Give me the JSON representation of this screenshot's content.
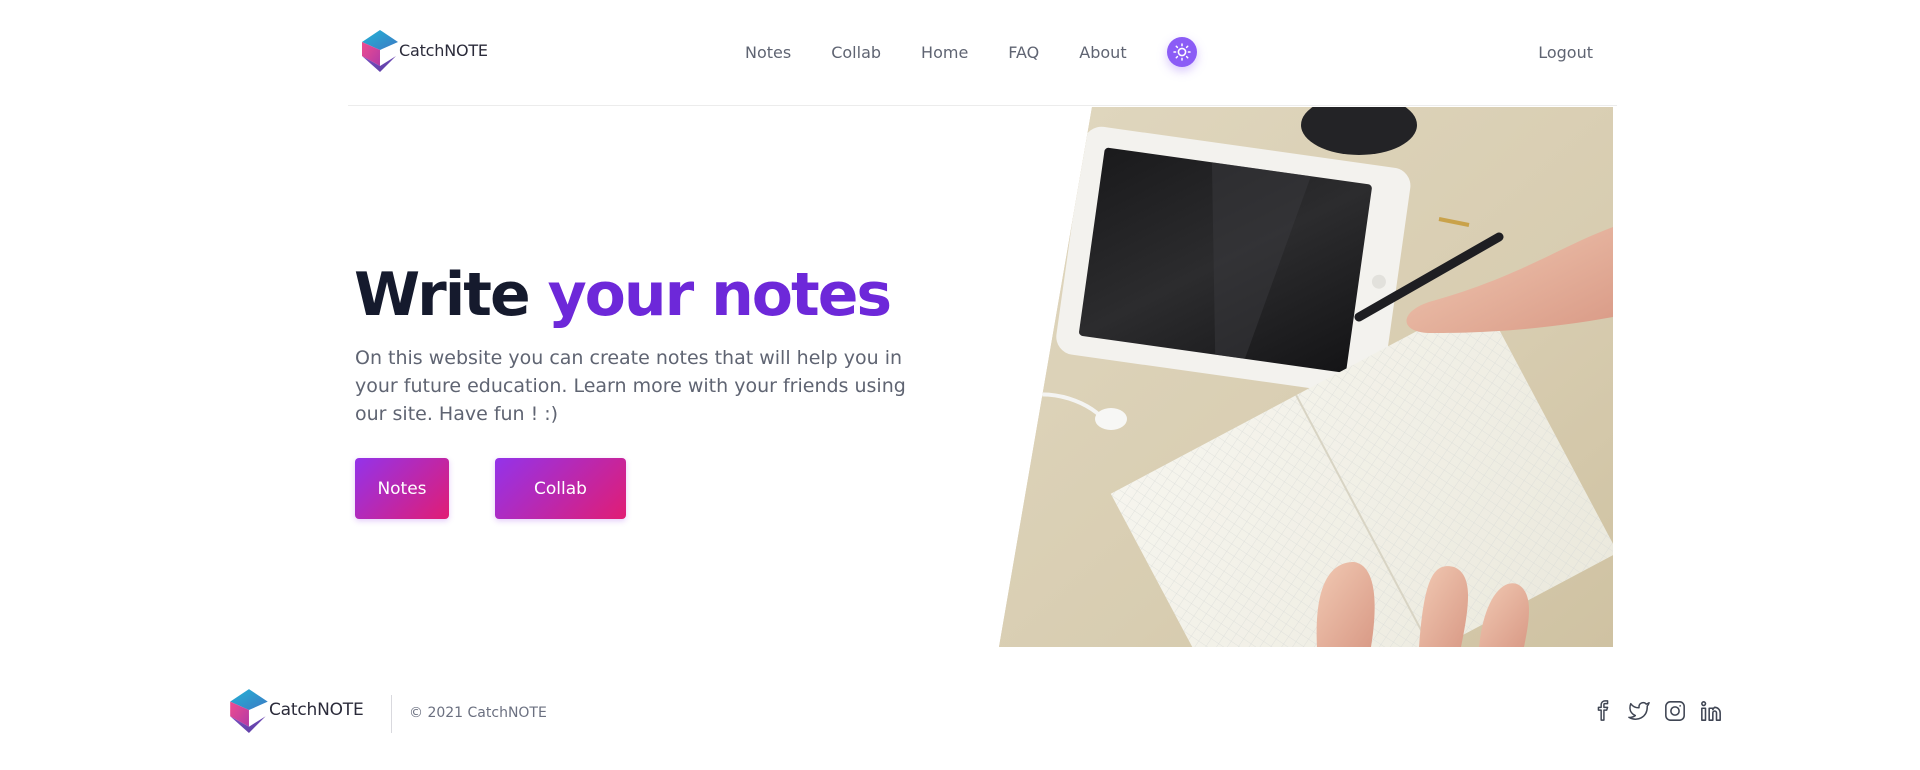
{
  "brand": {
    "name": "CatchNOTE"
  },
  "nav": {
    "items": [
      {
        "label": "Notes"
      },
      {
        "label": "Collab"
      },
      {
        "label": "Home"
      },
      {
        "label": "FAQ"
      },
      {
        "label": "About"
      }
    ],
    "theme_toggle_icon": "sun-icon",
    "logout_label": "Logout"
  },
  "hero": {
    "title_main": "Write",
    "title_accent": "your notes",
    "description": "On this website you can create notes that will help you in your future education. Learn more with your friends using our site. Have fun ! :)",
    "buttons": [
      {
        "label": "Notes"
      },
      {
        "label": "Collab"
      }
    ],
    "image_icon": "notebook-writing-photo"
  },
  "footer": {
    "brand": "CatchNOTE",
    "copyright": "© 2021 CatchNOTE",
    "socials": [
      {
        "icon": "facebook-icon"
      },
      {
        "icon": "twitter-icon"
      },
      {
        "icon": "instagram-icon"
      },
      {
        "icon": "linkedin-icon"
      }
    ]
  },
  "colors": {
    "accent": "#6d28d9",
    "button_gradient_start": "#9333ea",
    "button_gradient_end": "#e11d74",
    "text_muted": "#5f6472",
    "heading": "#151a2d"
  }
}
